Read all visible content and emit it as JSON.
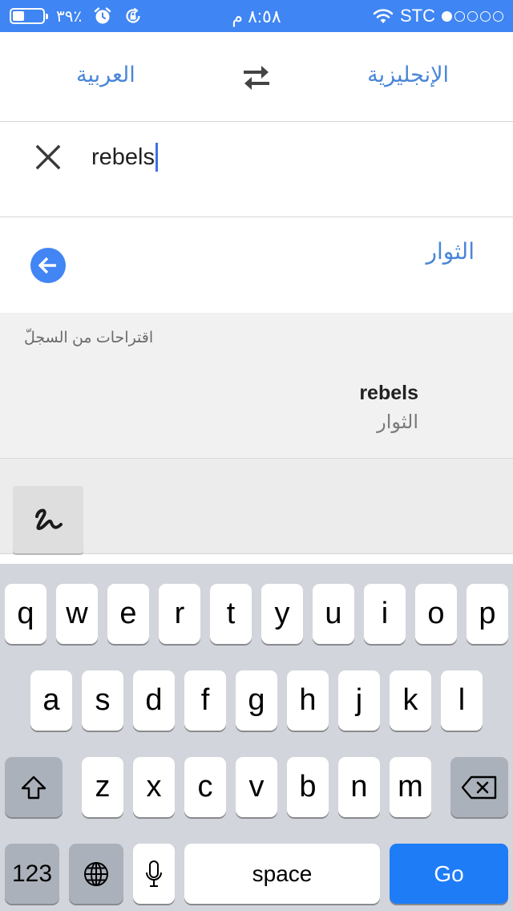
{
  "status_bar": {
    "time": "٨:٥٨ م",
    "battery_percent": "٣٩٪",
    "battery_level": 0.39,
    "carrier": "STC",
    "signal_strength": 1,
    "signal_max": 5,
    "icons": [
      "battery-icon",
      "alarm-icon",
      "orientation-lock-icon",
      "wifi-icon"
    ],
    "color": "#3f85f3"
  },
  "language_bar": {
    "source_language": "الإنجليزية",
    "target_language": "العربية",
    "swap_icon": "swap-arrows-icon"
  },
  "input": {
    "text": "rebels",
    "clear_icon": "close-icon"
  },
  "result": {
    "text": "الثوار",
    "back_icon": "arrow-left-circle-icon",
    "accent": "#4285f4"
  },
  "history": {
    "header": "اقتراحات من السجلّ",
    "items": [
      {
        "source": "rebels",
        "target": "الثوار"
      }
    ]
  },
  "tools": {
    "handwriting_icon": "handwriting-icon"
  },
  "keyboard": {
    "row1": [
      "q",
      "w",
      "e",
      "r",
      "t",
      "y",
      "u",
      "i",
      "o",
      "p"
    ],
    "row2": [
      "a",
      "s",
      "d",
      "f",
      "g",
      "h",
      "j",
      "k",
      "l"
    ],
    "row3": [
      "z",
      "x",
      "c",
      "v",
      "b",
      "n",
      "m"
    ],
    "numbers_label": "123",
    "space_label": "space",
    "go_label": "Go",
    "go_color": "#1e7cf7"
  }
}
